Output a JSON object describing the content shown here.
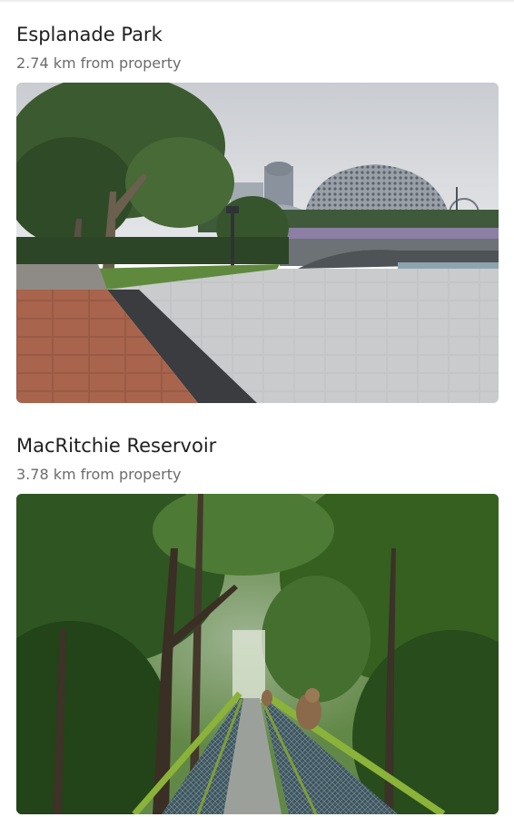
{
  "attractions": [
    {
      "name": "Esplanade Park",
      "distance": "2.74 km from property",
      "photo": "esplanade-park-photo"
    },
    {
      "name": "MacRitchie Reservoir",
      "distance": "3.78 km from property",
      "photo": "macritchie-reservoir-photo"
    }
  ]
}
